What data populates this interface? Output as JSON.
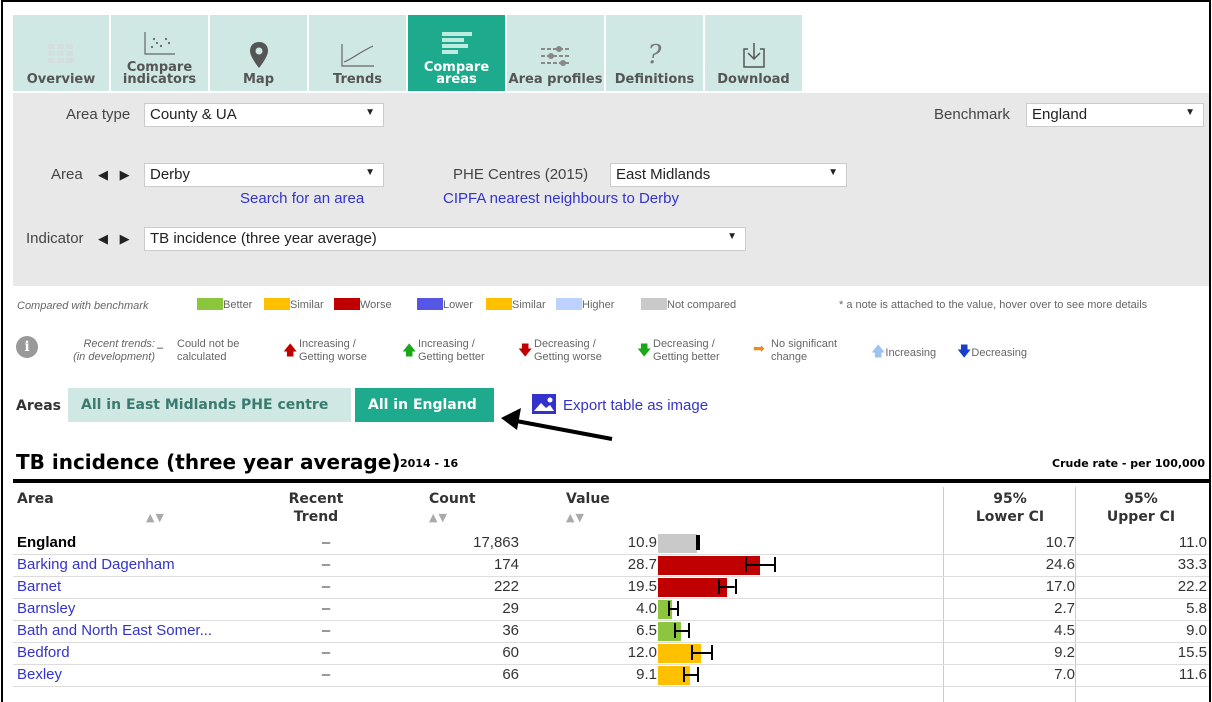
{
  "tabs": [
    {
      "label": "Overview",
      "icon": "overview-icon",
      "active": false
    },
    {
      "label": "Compare indicators",
      "icon": "scatter-icon",
      "active": false
    },
    {
      "label": "Map",
      "icon": "map-pin-icon",
      "active": false
    },
    {
      "label": "Trends",
      "icon": "trend-line-icon",
      "active": false
    },
    {
      "label": "Compare areas",
      "icon": "bar-list-icon",
      "active": true
    },
    {
      "label": "Area profiles",
      "icon": "sliders-icon",
      "active": false
    },
    {
      "label": "Definitions",
      "icon": "question-icon",
      "active": false
    },
    {
      "label": "Download",
      "icon": "download-icon",
      "active": false
    }
  ],
  "filters": {
    "area_type_label": "Area type",
    "area_type_value": "County & UA",
    "benchmark_label": "Benchmark",
    "benchmark_value": "England",
    "area_label": "Area",
    "area_value": "Derby",
    "search_link": "Search for an area",
    "phe_label": "PHE Centres (2015)",
    "phe_value": "East Midlands",
    "cipfa_link": "CIPFA nearest neighbours to Derby",
    "indicator_label": "Indicator",
    "indicator_value": "TB incidence (three year average)"
  },
  "legend": {
    "compared_label": "Compared with benchmark",
    "better": "Better",
    "similar": "Similar",
    "worse": "Worse",
    "lower": "Lower",
    "similar2": "Similar",
    "higher": "Higher",
    "not_compared": "Not compared",
    "note": "* a note is attached to the value, hover over to see more details",
    "recent_trends": "Recent trends:",
    "in_development": "(in development)",
    "t_na_1": "Could not be",
    "t_na_2": "calculated",
    "t_inc_worse_1": "Increasing /",
    "t_inc_worse_2": "Getting worse",
    "t_inc_better_1": "Increasing /",
    "t_inc_better_2": "Getting better",
    "t_dec_worse_1": "Decreasing /",
    "t_dec_worse_2": "Getting worse",
    "t_dec_better_1": "Decreasing /",
    "t_dec_better_2": "Getting better",
    "t_nochange_1": "No significant",
    "t_nochange_2": "change",
    "t_increasing": "Increasing",
    "t_decreasing": "Decreasing",
    "colors": {
      "better": "#8cc63f",
      "similar": "#ffc000",
      "worse": "#c00000",
      "lower": "#5555e6",
      "higher": "#bed2ff",
      "not_compared": "#c9c9c9"
    }
  },
  "areas_bar": {
    "label": "Areas",
    "tab_region": "All in East Midlands PHE centre",
    "tab_england": "All in England",
    "export_link": "Export table as image"
  },
  "table": {
    "title": "TB incidence (three year average)",
    "period": "2014 - 16",
    "unit": "Crude rate - per 100,000",
    "headers": {
      "area": "Area",
      "trend_1": "Recent",
      "trend_2": "Trend",
      "count": "Count",
      "value": "Value",
      "lci_1": "95%",
      "lci_2": "Lower CI",
      "uci_1": "95%",
      "uci_2": "Upper CI"
    },
    "sort_glyph": "▲▼",
    "rows": [
      {
        "area": "England",
        "trend": "–",
        "count": "17,863",
        "value": "10.9",
        "lower": "10.7",
        "upper": "11.0",
        "v": 10.9,
        "l": 10.7,
        "u": 11.0,
        "status": "not_compared",
        "bold": true
      },
      {
        "area": "Barking and Dagenham",
        "trend": "–",
        "count": "174",
        "value": "28.7",
        "lower": "24.6",
        "upper": "33.3",
        "v": 28.7,
        "l": 24.6,
        "u": 33.3,
        "status": "worse",
        "bold": false
      },
      {
        "area": "Barnet",
        "trend": "–",
        "count": "222",
        "value": "19.5",
        "lower": "17.0",
        "upper": "22.2",
        "v": 19.5,
        "l": 17.0,
        "u": 22.2,
        "status": "worse",
        "bold": false
      },
      {
        "area": "Barnsley",
        "trend": "–",
        "count": "29",
        "value": "4.0",
        "lower": "2.7",
        "upper": "5.8",
        "v": 4.0,
        "l": 2.7,
        "u": 5.8,
        "status": "better",
        "bold": false
      },
      {
        "area": "Bath and North East Somer...",
        "trend": "–",
        "count": "36",
        "value": "6.5",
        "lower": "4.5",
        "upper": "9.0",
        "v": 6.5,
        "l": 4.5,
        "u": 9.0,
        "status": "better",
        "bold": false
      },
      {
        "area": "Bedford",
        "trend": "–",
        "count": "60",
        "value": "12.0",
        "lower": "9.2",
        "upper": "15.5",
        "v": 12.0,
        "l": 9.2,
        "u": 15.5,
        "status": "similar",
        "bold": false
      },
      {
        "area": "Bexley",
        "trend": "–",
        "count": "66",
        "value": "9.1",
        "lower": "7.0",
        "upper": "11.6",
        "v": 9.1,
        "l": 7.0,
        "u": 11.6,
        "status": "similar",
        "bold": false
      }
    ]
  }
}
